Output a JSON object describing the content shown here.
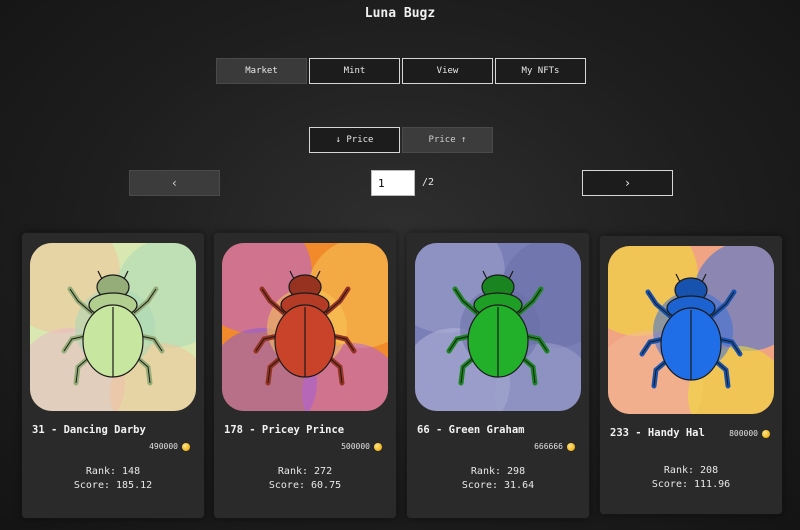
{
  "app": {
    "title": "Luna Bugz"
  },
  "nav": {
    "market": "Market",
    "mint": "Mint",
    "view": "View",
    "my_nfts": "My NFTs"
  },
  "sort": {
    "price_desc": "↓ Price",
    "price_asc": "Price ↑"
  },
  "pagination": {
    "prev": "‹",
    "next": "›",
    "current": "1",
    "total": "/2"
  },
  "cards": [
    {
      "name": "31 - Dancing Darby",
      "price": "490000",
      "rank_line": "Rank: 148",
      "score_line": "Score: 185.12",
      "bg_colors": [
        "#d9e8b0",
        "#f2c29a",
        "#a9d7b8",
        "#e9b8c8"
      ],
      "bug_color": "#c7e6a0"
    },
    {
      "name": "178 - Pricey Prince",
      "price": "500000",
      "rank_line": "Rank: 272",
      "score_line": "Score: 60.75",
      "bg_colors": [
        "#f08a2a",
        "#b760e0",
        "#f5c45a",
        "#8a5bd6"
      ],
      "bug_color": "#c8432a"
    },
    {
      "name": "66 - Green Graham",
      "price": "666666",
      "rank_line": "Rank: 298",
      "score_line": "Score: 31.64",
      "bg_colors": [
        "#7a7fb8",
        "#9da2cc",
        "#6b6fa8",
        "#b4b7d8"
      ],
      "bug_color": "#22b02a"
    },
    {
      "name": "233 - Handy Hal",
      "price": "800000",
      "rank_line": "Rank: 208",
      "score_line": "Score: 111.96",
      "bg_colors": [
        "#f0a483",
        "#f2e030",
        "#3a6fd8",
        "#f4b898"
      ],
      "bug_color": "#1f6ee8"
    }
  ]
}
